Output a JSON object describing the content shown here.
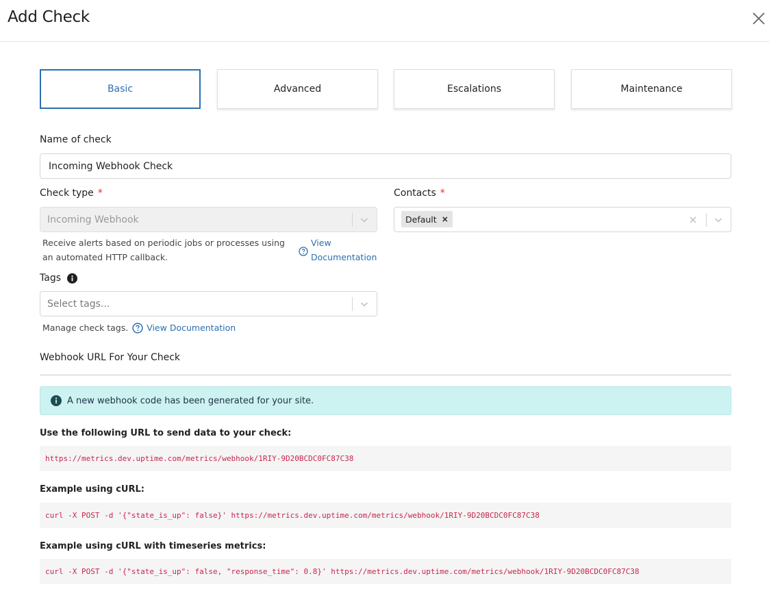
{
  "dialog": {
    "title": "Add Check",
    "close_icon": "close-icon"
  },
  "tabs": [
    {
      "label": "Basic",
      "active": true
    },
    {
      "label": "Advanced",
      "active": false
    },
    {
      "label": "Escalations",
      "active": false
    },
    {
      "label": "Maintenance",
      "active": false
    }
  ],
  "name_field": {
    "label": "Name of check",
    "value": "Incoming Webhook Check"
  },
  "check_type": {
    "label": "Check type",
    "required_mark": "*",
    "value": "Incoming Webhook",
    "help_text": "Receive alerts based on periodic jobs or processes using an automated HTTP callback.",
    "doc_link_line1": "View",
    "doc_link_line2": "Documentation"
  },
  "contacts": {
    "label": "Contacts",
    "required_mark": "*",
    "chip_label": "Default",
    "chip_remove": "×"
  },
  "tags": {
    "label": "Tags",
    "placeholder": "Select tags...",
    "help_text": "Manage check tags.",
    "doc_link": "View Documentation"
  },
  "webhook": {
    "section_title": "Webhook URL For Your Check",
    "alert_text": "A new webhook code has been generated for your site.",
    "url_label": "Use the following URL to send data to your check:",
    "url": "https://metrics.dev.uptime.com/metrics/webhook/1RIY-9D20BCDC0FC87C38",
    "curl_label": "Example using cURL:",
    "curl": "curl -X POST -d '{\"state_is_up\": false}' https://metrics.dev.uptime.com/metrics/webhook/1RIY-9D20BCDC0FC87C38",
    "curl_ts_label": "Example using cURL with timeseries metrics:",
    "curl_ts": "curl -X POST -d '{\"state_is_up\": false, \"response_time\": 0.8}' https://metrics.dev.uptime.com/metrics/webhook/1RIY-9D20BCDC0FC87C38"
  },
  "colors": {
    "accent": "#2a6fb0",
    "required": "#d9342b",
    "alert_bg": "#cdf2f2",
    "code_text": "#c7254e"
  }
}
